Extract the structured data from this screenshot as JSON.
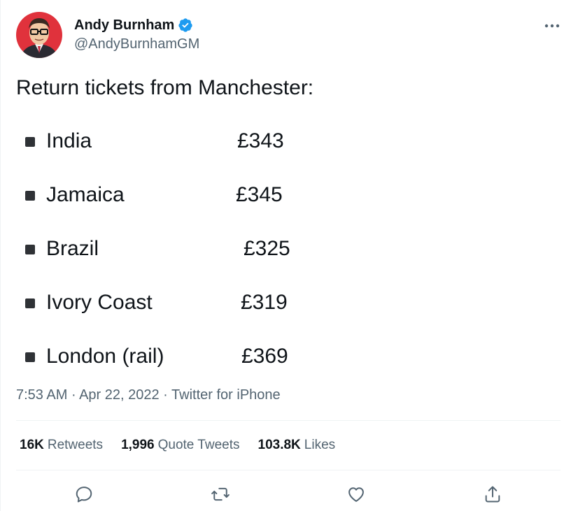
{
  "author": {
    "display_name": "Andy Burnham",
    "handle": "@AndyBurnhamGM"
  },
  "tweet": {
    "text": "Return tickets from Manchester:",
    "items": [
      {
        "label": "India",
        "price": "£343"
      },
      {
        "label": "Jamaica",
        "price": "£345"
      },
      {
        "label": "Brazil",
        "price": "£325"
      },
      {
        "label": "Ivory Coast",
        "price": "£319"
      },
      {
        "label": "London (rail)",
        "price": "£369"
      }
    ]
  },
  "meta": {
    "time": "7:53 AM",
    "separator": "·",
    "date": "Apr 22, 2022",
    "source": "Twitter for iPhone"
  },
  "stats": {
    "retweets_count": "16K",
    "retweets_label": "Retweets",
    "quotes_count": "1,996",
    "quotes_label": "Quote Tweets",
    "likes_count": "103.8K",
    "likes_label": "Likes"
  },
  "icons": {
    "more": "more-horizontal-icon",
    "reply": "reply-icon",
    "retweet": "retweet-icon",
    "like": "heart-icon",
    "share": "share-icon",
    "verified": "verified-badge-icon"
  },
  "colors": {
    "text": "#0f1419",
    "secondary": "#536471",
    "verified": "#1d9bf0",
    "avatar_bg": "#e0323c",
    "divider": "#eff3f4"
  }
}
